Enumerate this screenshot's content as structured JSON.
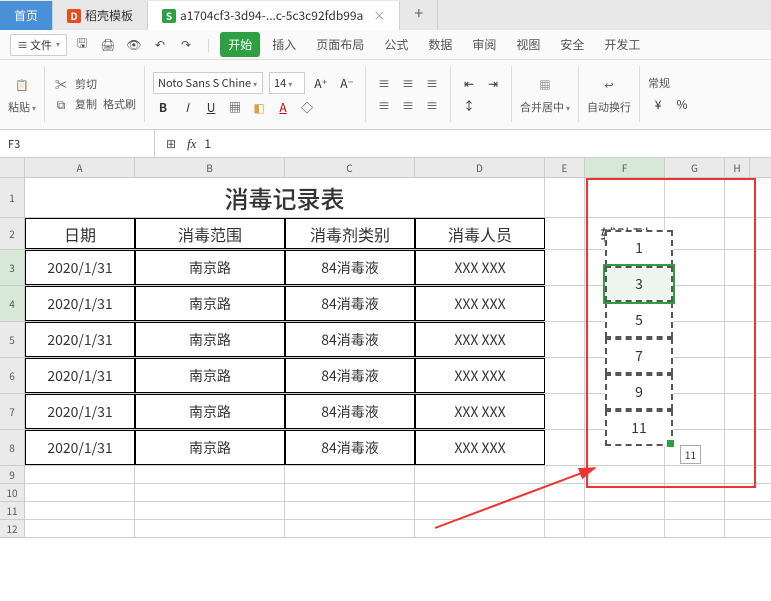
{
  "tabs": {
    "home": "首页",
    "template": "稻壳模板",
    "file": "a1704cf3-3d94-...c-5c3c92fdb99a"
  },
  "menubar": {
    "file": "文件",
    "items": [
      "开始",
      "插入",
      "页面布局",
      "公式",
      "数据",
      "审阅",
      "视图",
      "安全",
      "开发工"
    ]
  },
  "ribbon": {
    "cut": "剪切",
    "copy": "复制",
    "format": "格式刷",
    "paste": "粘贴",
    "font": "Noto Sans S Chine",
    "size": "14",
    "merge": "合并居中",
    "wrap": "自动换行",
    "general": "常规"
  },
  "namebox": "F3",
  "formula": "1",
  "cols": [
    "A",
    "B",
    "C",
    "D",
    "E",
    "F",
    "G",
    "H"
  ],
  "rows": [
    "1",
    "2",
    "3",
    "4",
    "5",
    "6",
    "7",
    "8",
    "9",
    "10",
    "11",
    "12"
  ],
  "title": "消毒记录表",
  "headers": [
    "日期",
    "消毒范围",
    "消毒剂类别",
    "消毒人员"
  ],
  "auxheader": "辅助列",
  "data": [
    [
      "2020/1/31",
      "南京路",
      "84消毒液",
      "XXX XXX"
    ],
    [
      "2020/1/31",
      "南京路",
      "84消毒液",
      "XXX XXX"
    ],
    [
      "2020/1/31",
      "南京路",
      "84消毒液",
      "XXX XXX"
    ],
    [
      "2020/1/31",
      "南京路",
      "84消毒液",
      "XXX XXX"
    ],
    [
      "2020/1/31",
      "南京路",
      "84消毒液",
      "XXX XXX"
    ],
    [
      "2020/1/31",
      "南京路",
      "84消毒液",
      "XXX XXX"
    ]
  ],
  "aux": [
    "1",
    "3",
    "5",
    "7",
    "9",
    "11"
  ],
  "tooltip": "11",
  "fx": "fx",
  "chart_data": null
}
